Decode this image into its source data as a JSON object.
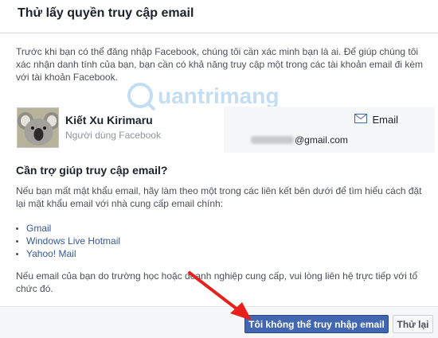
{
  "dialog": {
    "title": "Thử lấy quyền truy cập email",
    "intro": "Trước khi bạn có thể đăng nhập Facebook, chúng tôi cần xác minh bạn là ai. Để giúp chúng tôi xác nhận danh tính của bạn, bạn cần có khả năng truy cập một trong các tài khoản email đi kèm với tài khoản Facebook."
  },
  "profile": {
    "name": "Kiết Xu Kirimaru",
    "subtitle": "Người dùng Facebook"
  },
  "email": {
    "label": "Email",
    "domain": "@gmail.com"
  },
  "help": {
    "heading": "Cần trợ giúp truy cập email?",
    "text": "Nếu bạn mất mật khẩu email, hãy làm theo một trong các liên kết bên dưới để tìm hiểu cách đặt lại mật khẩu email với nhà cung cấp email chính:",
    "providers": [
      "Gmail",
      "Windows Live Hotmail",
      "Yahoo! Mail"
    ],
    "note": "Nếu email của bạn do trường học hoặc doanh nghiệp cung cấp, vui lòng liên hệ trực tiếp với tổ chức đó."
  },
  "footer": {
    "primary_label": "Tôi không thể truy nhập email",
    "secondary_label": "Thử lại"
  },
  "watermark": {
    "text": "uantrimang"
  },
  "colors": {
    "primary": "#4267b2",
    "link": "#365899",
    "arrow": "#e8201a"
  },
  "icons": {
    "email": "envelope-icon",
    "avatar": "koala-avatar"
  }
}
